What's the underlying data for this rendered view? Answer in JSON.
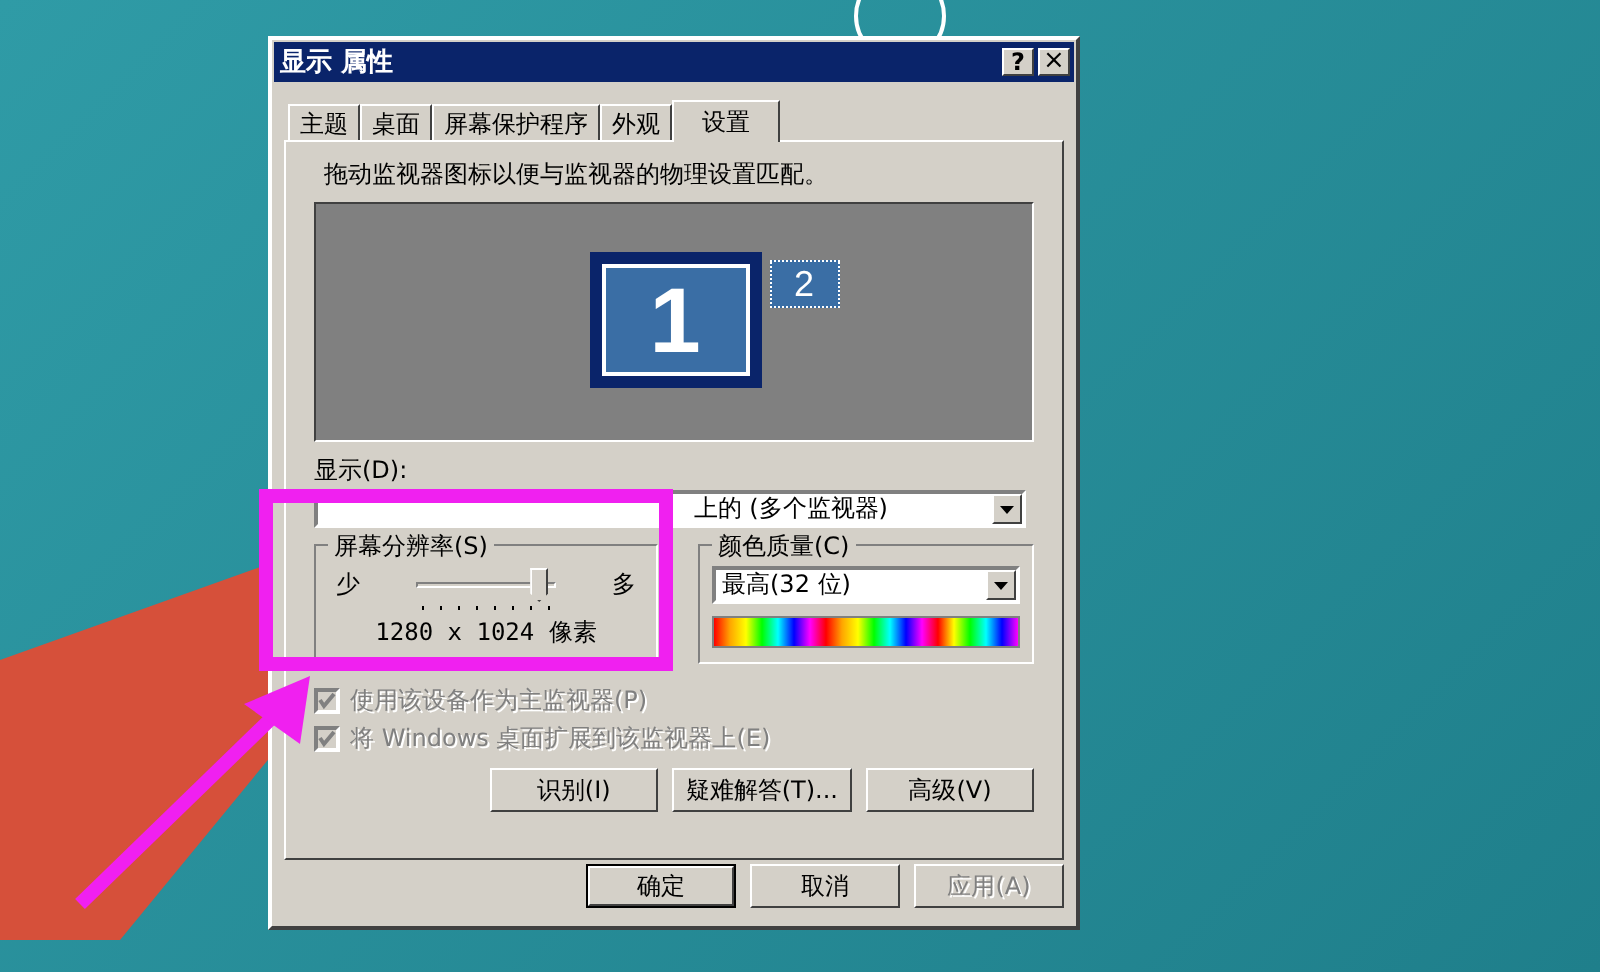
{
  "window": {
    "title": "显示 属性",
    "title_buttons": [
      {
        "kind": "help",
        "label": "?"
      },
      {
        "kind": "close",
        "label": "×"
      }
    ]
  },
  "tabs": [
    {
      "label": "主题",
      "selected": false
    },
    {
      "label": "桌面",
      "selected": false
    },
    {
      "label": "屏幕保护程序",
      "selected": false
    },
    {
      "label": "外观",
      "selected": false
    },
    {
      "label": "设置",
      "selected": true
    }
  ],
  "instruction": "拖动监视器图标以便与监视器的物理设置匹配。",
  "monitors": [
    {
      "label": "1",
      "selected": true
    },
    {
      "label": "2",
      "selected": false
    }
  ],
  "display": {
    "label": "显示(D):",
    "value": "上的 (多个监视器)"
  },
  "resolution": {
    "label": "屏幕分辨率(S)",
    "min_label": "少",
    "max_label": "多",
    "level": 0.857,
    "reading": "1280 x 1024 像素"
  },
  "color_quality": {
    "label": "颜色质量(C)",
    "value": "最高(32 位)"
  },
  "checkboxes": [
    {
      "label": "使用该设备作为主监视器(P)",
      "checked": true,
      "disabled": true
    },
    {
      "label": "将 Windows 桌面扩展到该监视器上(E)",
      "checked": true,
      "disabled": true
    }
  ],
  "actions": [
    {
      "label": "识别(I)"
    },
    {
      "label": "疑难解答(T)..."
    },
    {
      "label": "高级(V)"
    }
  ],
  "footer_buttons": [
    {
      "label": "确定",
      "default": true,
      "disabled": false
    },
    {
      "label": "取消",
      "default": false,
      "disabled": false
    },
    {
      "label": "应用(A)",
      "default": false,
      "disabled": true
    }
  ]
}
